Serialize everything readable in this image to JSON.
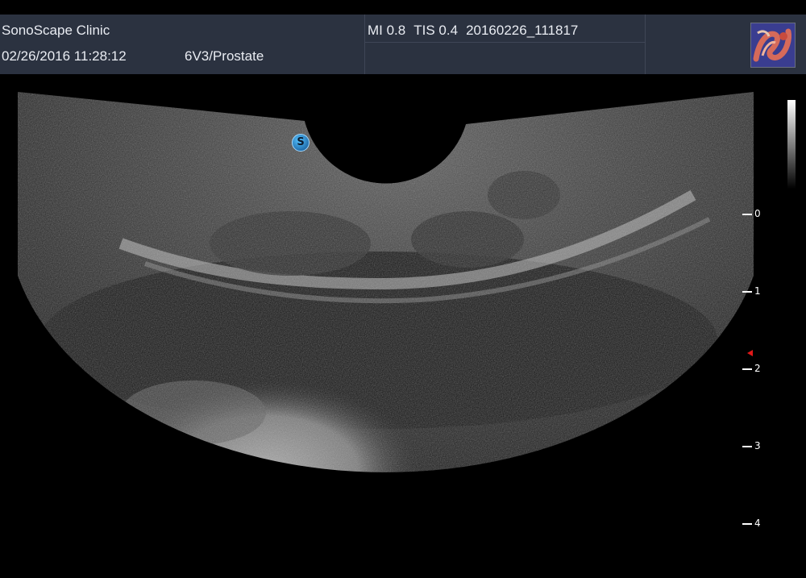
{
  "header": {
    "clinic_name": "SonoScape Clinic",
    "datetime": "02/26/2016 11:28:12",
    "probe_preset": "6V3/Prostate",
    "mi": "MI  0.8",
    "tis": "TIS 0.4",
    "exam_id": "20160226_111817",
    "logo_icon": "organ-logo-icon"
  },
  "scan": {
    "probe_marker_label": "S",
    "depth_scale_cm": [
      "0",
      "1",
      "2",
      "3",
      "4"
    ],
    "focus_marker_color": "#e01818"
  },
  "colors": {
    "header_bg": "#2b3240",
    "header_text": "#e9ecf2",
    "background": "#000000"
  }
}
